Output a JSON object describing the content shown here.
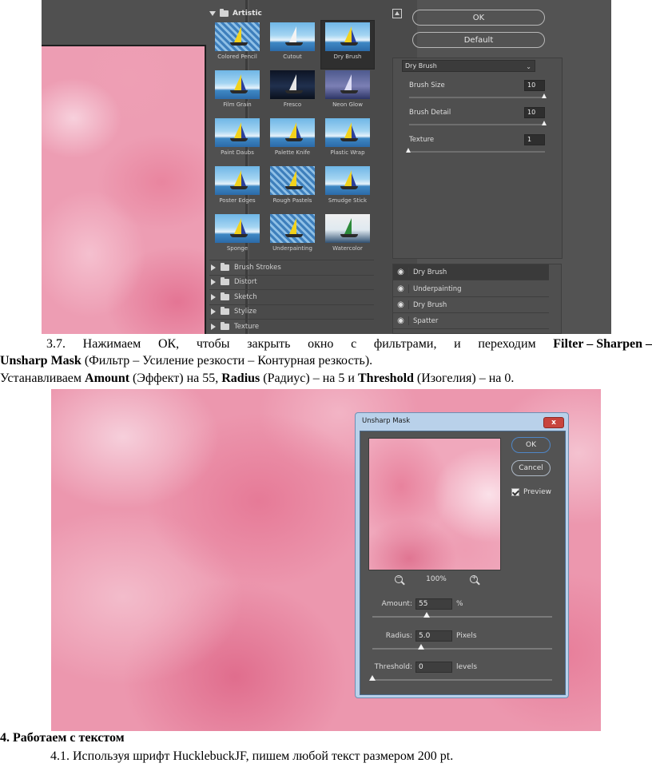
{
  "filter_gallery": {
    "category_open": "Artistic",
    "thumbnails": [
      {
        "label": "Colored Pencil"
      },
      {
        "label": "Cutout"
      },
      {
        "label": "Dry Brush"
      },
      {
        "label": "Film Grain"
      },
      {
        "label": "Fresco"
      },
      {
        "label": "Neon Glow"
      },
      {
        "label": "Paint Daubs"
      },
      {
        "label": "Palette Knife"
      },
      {
        "label": "Plastic Wrap"
      },
      {
        "label": "Poster Edges"
      },
      {
        "label": "Rough Pastels"
      },
      {
        "label": "Smudge Stick"
      },
      {
        "label": "Sponge"
      },
      {
        "label": "Underpainting"
      },
      {
        "label": "Watercolor"
      }
    ],
    "selected_thumbnail": "Dry Brush",
    "categories": [
      "Brush Strokes",
      "Distort",
      "Sketch",
      "Stylize",
      "Texture"
    ],
    "ok_label": "OK",
    "default_label": "Default",
    "filter_select": "Dry Brush",
    "params": [
      {
        "label": "Brush Size",
        "value": "10",
        "level": 1.0
      },
      {
        "label": "Brush Detail",
        "value": "10",
        "level": 1.0
      },
      {
        "label": "Texture",
        "value": "1",
        "level": 0.0
      }
    ],
    "layers": [
      "Dry Brush",
      "Underpainting",
      "Dry Brush",
      "Spatter"
    ]
  },
  "text": {
    "p1_words": [
      "3.7.",
      "Нажимаем",
      "ОК,",
      "чтобы",
      "закрыть",
      "окно",
      "с",
      "фильтрами,",
      "и",
      "переходим"
    ],
    "p1_bold": "Filter – Sharpen –",
    "p2_bold": "Unsharp Mask",
    "p2_rest": " (Фильтр – Усиление резкости – Контурная резкость).",
    "p3_a": "Устанавливаем ",
    "p3_amount": "Amount",
    "p3_b": " (Эффект) на 55, ",
    "p3_radius": "Radius",
    "p3_c": " (Радиус) – на 5 и ",
    "p3_threshold": "Threshold",
    "p3_d": " (Изогелия) – на 0.",
    "section_heading": "4. Работаем с текстом",
    "p5": "4.1. Используя шрифт HucklebuckJF, пишем любой текст размером 200 pt."
  },
  "unsharp_mask": {
    "title": "Unsharp Mask",
    "close_label": "x",
    "ok_label": "OK",
    "cancel_label": "Cancel",
    "preview_label": "Preview",
    "preview_checked": true,
    "zoom": "100%",
    "params": [
      {
        "label": "Amount:",
        "value": "55",
        "unit": "%",
        "level": 0.3
      },
      {
        "label": "Radius:",
        "value": "5.0",
        "unit": "Pixels",
        "level": 0.27
      },
      {
        "label": "Threshold:",
        "value": "0",
        "unit": "levels",
        "level": 0.0
      }
    ]
  }
}
